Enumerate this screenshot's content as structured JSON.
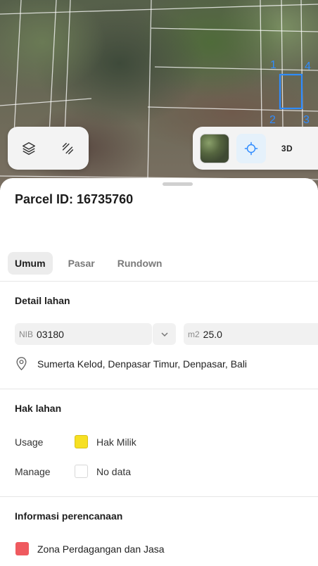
{
  "map": {
    "parcel_corner_labels": [
      "1",
      "4",
      "2",
      "3"
    ],
    "highlight_color": "#2f8cff",
    "toolbar_left": {
      "icons": [
        "layers-icon",
        "route-icon"
      ]
    },
    "toolbar_right": {
      "icons": [
        "satellite-thumbnail",
        "locate-crosshair-icon"
      ],
      "mode_3d_label": "3D"
    }
  },
  "sheet": {
    "parcel_title": "Parcel ID: 16735760",
    "tabs": [
      {
        "label": "Umum",
        "active": true
      },
      {
        "label": "Pasar",
        "active": false
      },
      {
        "label": "Rundown",
        "active": false
      }
    ],
    "detail_lahan": {
      "title": "Detail lahan",
      "nib_prefix": "NIB",
      "nib_value": "03180",
      "area_prefix": "m2",
      "area_value": "25.0",
      "address": "Sumerta Kelod, Denpasar Timur, Denpasar, Bali"
    },
    "hak_lahan": {
      "title": "Hak lahan",
      "usage_label": "Usage",
      "usage_value": "Hak Milik",
      "usage_color": "#f7e022",
      "manage_label": "Manage",
      "manage_value": "No data",
      "manage_color": "#ffffff"
    },
    "informasi_perencanaan": {
      "title": "Informasi perencanaan",
      "zone_label": "Zona Perdagangan dan Jasa",
      "zone_color": "#ef5a5f"
    }
  }
}
